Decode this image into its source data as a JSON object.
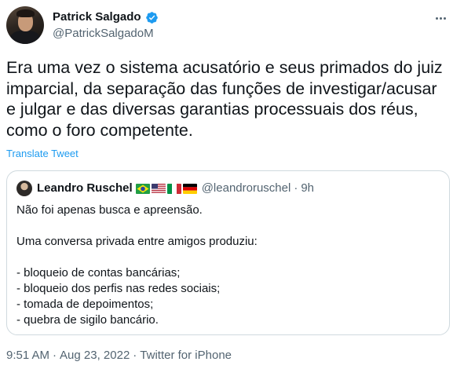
{
  "author": {
    "name": "Patrick Salgado",
    "handle": "@PatrickSalgadoM",
    "verified": true
  },
  "tweet": {
    "text": "Era uma vez o sistema acusatório e seus primados do juiz imparcial, da separação das funções de investigar/acusar e julgar e das diversas garantias processuais dos réus, como o foro competente.",
    "translate_label": "Translate Tweet"
  },
  "quoted_tweet": {
    "name": "Leandro Ruschel",
    "flags": [
      "brazil-flag-icon",
      "usa-flag-icon",
      "italy-flag-icon",
      "germany-flag-icon"
    ],
    "handle": "@leandroruschel",
    "separator": "·",
    "time": "9h",
    "lines": [
      "Não foi apenas busca e apreensão.",
      "",
      "Uma conversa privada entre amigos produziu:",
      "",
      "- bloqueio de contas bancárias;",
      "- bloqueio dos perfis nas redes sociais;",
      "- tomada de depoimentos;",
      "- quebra de sigilo bancário."
    ]
  },
  "footer": {
    "time": "9:51 AM",
    "separator1": "·",
    "date": "Aug 23, 2022",
    "separator2": "·",
    "source": "Twitter for iPhone"
  },
  "colors": {
    "text": "#0f1419",
    "secondary": "#536471",
    "link": "#1d9bf0",
    "border": "#cfd9de"
  }
}
